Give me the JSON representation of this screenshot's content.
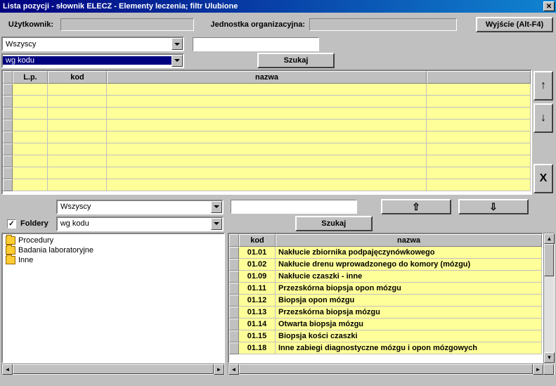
{
  "title": "Lista pozycji - słownik ELECZ - Elementy leczenia; filtr Ulubione",
  "header": {
    "user_label": "Użytkownik:",
    "org_label": "Jednostka organizacyjna:",
    "exit_btn": "Wyjście (Alt-F4)"
  },
  "top_filter": {
    "select1": "Wszyscy",
    "select2": "wg kodu",
    "search_btn": "Szukaj"
  },
  "grid1_headers": {
    "lp": "L.p.",
    "kod": "kod",
    "nazwa": "nazwa"
  },
  "side_buttons": {
    "up": "↑",
    "down": "↓",
    "delete": "X"
  },
  "bottom_filter": {
    "select1": "Wszyscy",
    "select2": "wg kodu",
    "search_btn": "Szukaj",
    "move_up": "⇧",
    "move_down": "⇩",
    "foldery_label": "Foldery"
  },
  "tree_items": [
    "Procedury",
    "Badania laboratoryjne",
    "Inne"
  ],
  "grid2_headers": {
    "kod": "kod",
    "nazwa": "nazwa"
  },
  "grid2_rows": [
    {
      "kod": "01.01",
      "nazwa": "Nakłucie zbiornika podpajęczynówkowego"
    },
    {
      "kod": "01.02",
      "nazwa": "Nakłucie drenu wprowadzonego do komory (mózgu)"
    },
    {
      "kod": "01.09",
      "nazwa": "Nakłucie czaszki - inne"
    },
    {
      "kod": "01.11",
      "nazwa": "Przezskórna biopsja opon mózgu"
    },
    {
      "kod": "01.12",
      "nazwa": "Biopsja opon mózgu"
    },
    {
      "kod": "01.13",
      "nazwa": "Przezskórna biopsja mózgu"
    },
    {
      "kod": "01.14",
      "nazwa": "Otwarta biopsja mózgu"
    },
    {
      "kod": "01.15",
      "nazwa": "Biopsja kości czaszki"
    },
    {
      "kod": "01.18",
      "nazwa": "Inne zabiegi diagnostyczne mózgu i opon mózgowych"
    }
  ]
}
